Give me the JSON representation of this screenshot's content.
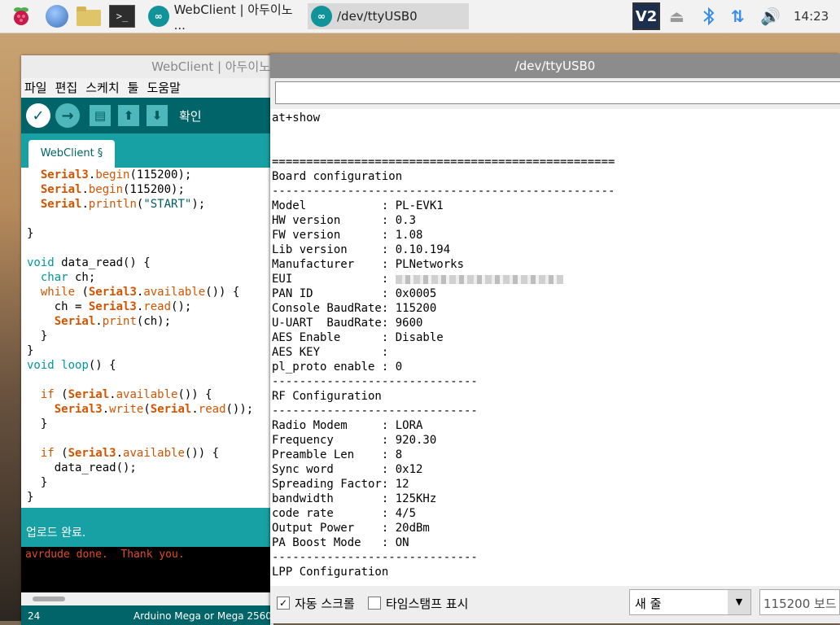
{
  "taskbar": {
    "tasks": [
      {
        "label": "WebClient | 아두이노 ..."
      },
      {
        "label": "/dev/ttyUSB0"
      }
    ],
    "vnc_label": "V2",
    "clock": "14:23"
  },
  "arduino": {
    "title": "WebClient | 아두이노",
    "menu": [
      "파일",
      "편집",
      "스케치",
      "툴",
      "도움말"
    ],
    "toolbar_label": "확인",
    "tab": "WebClient §",
    "status": "업로드 완료.",
    "console": "avrdude done.  Thank you.",
    "line_number": "24",
    "board": "Arduino Mega or Mega 2560,"
  },
  "serial": {
    "title": "/dev/ttyUSB0",
    "input_value": "",
    "output_lines": [
      "at+show",
      "",
      "",
      "==================================================",
      "Board configuration",
      "--------------------------------------------------",
      "Model           : PL-EVK1",
      "HW version      : 0.3",
      "FW version      : 1.08",
      "Lib version     : 0.10.194",
      "Manufacturer    : PLNetworks",
      "EUI             : ",
      "PAN ID          : 0x0005",
      "Console BaudRate: 115200",
      "U-UART  BaudRate: 9600",
      "AES Enable      : Disable",
      "AES KEY         :",
      "pl_proto enable : 0",
      "------------------------------",
      "RF Configuration",
      "------------------------------",
      "Radio Modem     : LORA",
      "Frequency       : 920.30",
      "Preamble Len    : 8",
      "Sync word       : 0x12",
      "Spreading Factor: 12",
      "bandwidth       : 125KHz",
      "code rate       : 4/5",
      "Output Power    : 20dBm",
      "PA Boost Mode   : ON",
      "------------------------------",
      "LPP Configuration"
    ],
    "autoscroll_label": "자동 스크롤",
    "timestamp_label": "타임스탬프 표시",
    "line_ending": "새 줄",
    "baud": "115200 보드"
  }
}
